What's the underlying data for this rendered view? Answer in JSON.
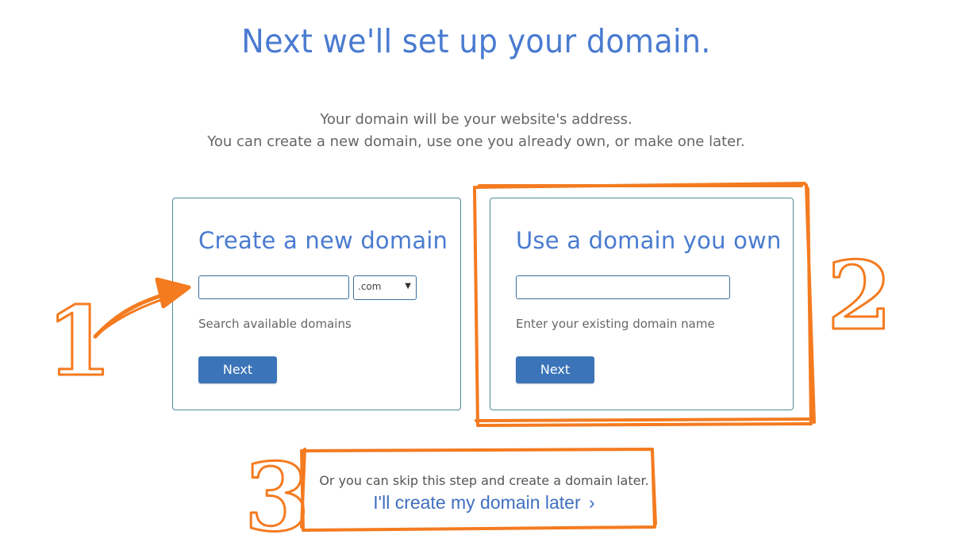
{
  "header": {
    "title": "Next we'll set up your domain.",
    "subtitle_line1": "Your domain will be your website's address.",
    "subtitle_line2": "You can create a new domain, use one you already own, or make one later."
  },
  "new_domain": {
    "heading": "Create a new domain",
    "input_value": "",
    "tld_selected": ".com",
    "hint": "Search available domains",
    "button_label": "Next"
  },
  "existing_domain": {
    "heading": "Use a domain you own",
    "input_value": "",
    "hint": "Enter your existing domain name",
    "button_label": "Next"
  },
  "skip": {
    "text": "Or you can skip this step and create a domain later.",
    "link_label": "I'll create my domain later",
    "link_chevron": "›"
  },
  "annotations": {
    "number_1": "1",
    "number_2": "2",
    "number_3": "3",
    "accent_color": "#f47b20"
  },
  "colors": {
    "title": "#4a7bd0",
    "button": "#3b74b8",
    "card_border": "#4f8a9a"
  }
}
